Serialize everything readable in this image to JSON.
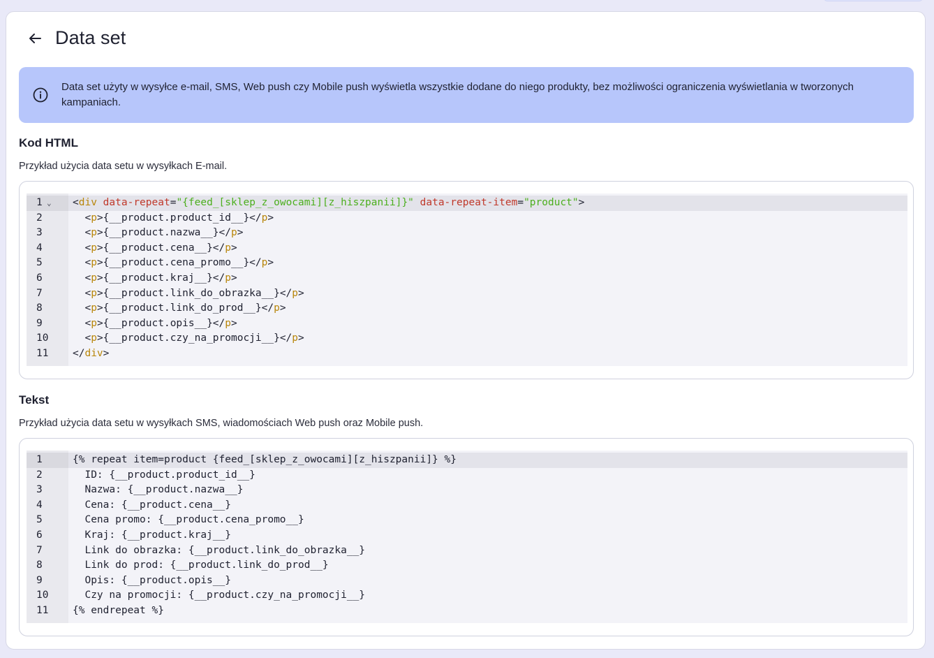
{
  "header": {
    "title": "Data set"
  },
  "info": {
    "text": "Data set użyty w wysyłce e-mail, SMS, Web push czy Mobile push wyświetla wszystkie dodane do niego produkty, bez możliwości ograniczenia wyświetlania w tworzonych kampaniach."
  },
  "html_section": {
    "title": "Kod HTML",
    "description": "Przykład użycia data setu w wysyłkach E-mail.",
    "line_numbers": [
      "1",
      "2",
      "3",
      "4",
      "5",
      "6",
      "7",
      "8",
      "9",
      "10",
      "11"
    ],
    "lines": [
      "<div data-repeat=\"{feed_[sklep_z_owocami][z_hiszpanii]}\" data-repeat-item=\"product\">",
      "  <p>{__product.product_id__}</p>",
      "  <p>{__product.nazwa__}</p>",
      "  <p>{__product.cena__}</p>",
      "  <p>{__product.cena_promo__}</p>",
      "  <p>{__product.kraj__}</p>",
      "  <p>{__product.link_do_obrazka__}</p>",
      "  <p>{__product.link_do_prod__}</p>",
      "  <p>{__product.opis__}</p>",
      "  <p>{__product.czy_na_promocji__}</p>",
      "</div>"
    ]
  },
  "text_section": {
    "title": "Tekst",
    "description": "Przykład użycia data setu w wysyłkach SMS, wiadomościach Web push oraz Mobile push.",
    "line_numbers": [
      "1",
      "2",
      "3",
      "4",
      "5",
      "6",
      "7",
      "8",
      "9",
      "10",
      "11"
    ],
    "lines": [
      "{% repeat item=product {feed_[sklep_z_owocami][z_hiszpanii]} %}",
      "  ID: {__product.product_id__}",
      "  Nazwa: {__product.nazwa__}",
      "  Cena: {__product.cena__}",
      "  Cena promo: {__product.cena_promo__}",
      "  Kraj: {__product.kraj__}",
      "  Link do obrazka: {__product.link_do_obrazka__}",
      "  Link do prod: {__product.link_do_prod__}",
      "  Opis: {__product.opis__}",
      "  Czy na promocji: {__product.czy_na_promocji__}",
      "{% endrepeat %}"
    ]
  },
  "icons": {
    "back": "arrow-left-icon",
    "info": "info-circle-icon",
    "fold": "chevron-down-icon"
  },
  "colors": {
    "info_bg": "#b7c6fb",
    "tag": "#b8860b",
    "attr": "#c0392b",
    "string": "#4caf1e"
  }
}
